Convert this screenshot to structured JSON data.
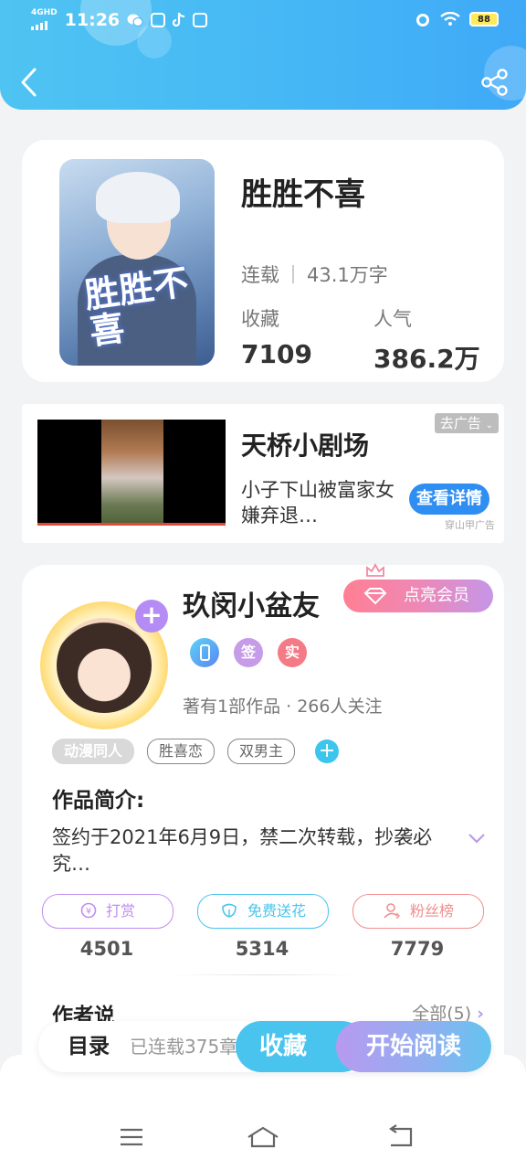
{
  "status_bar": {
    "network": "4GHD",
    "time": "11:26",
    "battery": "88"
  },
  "book": {
    "title": "胜胜不喜",
    "cover_text": "胜胜不喜",
    "status": "连载",
    "word_count": "43.1万字",
    "favorites_label": "收藏",
    "favorites_value": "7109",
    "popularity_label": "人气",
    "popularity_value": "386.2万"
  },
  "ad": {
    "close_label": "去广告",
    "title": "天桥小剧场",
    "description": "小子下山被富家女嫌弃退…",
    "button_label": "查看详情",
    "source": "穿山甲广告"
  },
  "author": {
    "name": "玖闵小盆友",
    "vip_label": "点亮会员",
    "badges": [
      {
        "label": "",
        "color": "#4aa8f5"
      },
      {
        "label": "签",
        "color": "#c69be8"
      },
      {
        "label": "实",
        "color": "#f47a86"
      }
    ],
    "meta": "著有1部作品 · 266人关注",
    "tags": [
      "动漫同人",
      "胜喜恋",
      "双男主"
    ],
    "synopsis_title": "作品简介:",
    "synopsis": "签约于2021年6月9日，禁二次转载，抄袭必究…",
    "actions": [
      {
        "label": "打赏",
        "count": "4501",
        "color": "#c08ef0"
      },
      {
        "label": "免费送花",
        "count": "5314",
        "color": "#4ac4ee"
      },
      {
        "label": "粉丝榜",
        "count": "7779",
        "color": "#f28d8d"
      }
    ],
    "author_says_title": "作者说",
    "all_link": "全部(5)"
  },
  "bottom_bar": {
    "toc_label": "目录",
    "serial_status": "已连载375章",
    "collect_label": "收藏",
    "read_label": "开始阅读"
  },
  "colors": {
    "header_start": "#4fc4f2",
    "header_end": "#3fa9f7",
    "accent_blue": "#49c4ef",
    "accent_purple": "#b79af0"
  }
}
